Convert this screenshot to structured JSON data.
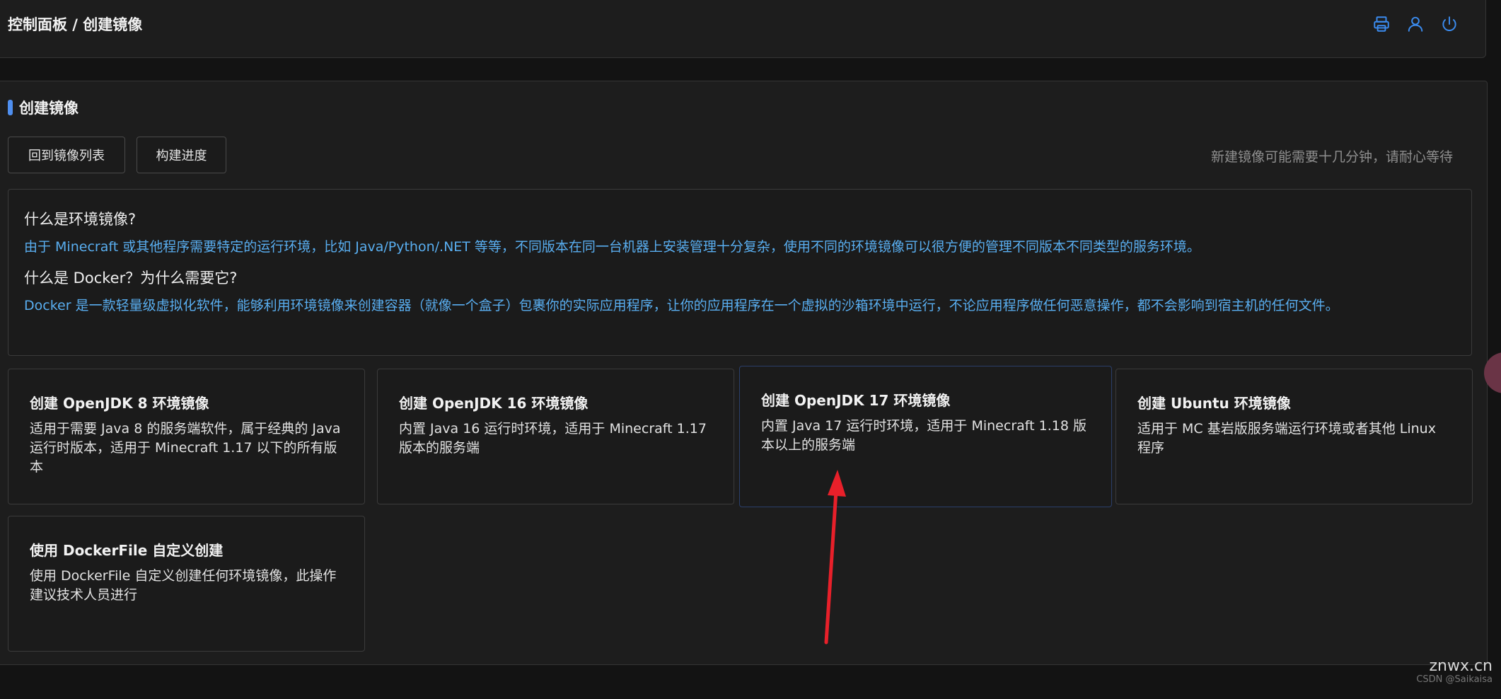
{
  "header": {
    "breadcrumb": "控制面板 / 创建镜像",
    "icons": [
      "printer-icon",
      "user-icon",
      "power-icon"
    ]
  },
  "panel": {
    "title": "创建镜像",
    "buttons": {
      "back": "回到镜像列表",
      "progress": "构建进度"
    },
    "hint": "新建镜像可能需要十几分钟，请耐心等待"
  },
  "info": {
    "q1": "什么是环境镜像?",
    "a1": "由于 Minecraft 或其他程序需要特定的运行环境，比如 Java/Python/.NET 等等，不同版本在同一台机器上安装管理十分复杂，使用不同的环境镜像可以很方便的管理不同版本不同类型的服务环境。",
    "q2": "什么是 Docker？为什么需要它?",
    "a2": "Docker 是一款轻量级虚拟化软件，能够利用环境镜像来创建容器（就像一个盒子）包裹你的实际应用程序，让你的应用程序在一个虚拟的沙箱环境中运行，不论应用程序做任何恶意操作，都不会影响到宿主机的任何文件。"
  },
  "cards": [
    {
      "title": "创建 OpenJDK 8 环境镜像",
      "desc": "适用于需要 Java 8 的服务端软件，属于经典的 Java 运行时版本，适用于 Minecraft 1.17 以下的所有版本"
    },
    {
      "title": "创建 OpenJDK 16 环境镜像",
      "desc": "内置 Java 16 运行时环境，适用于 Minecraft 1.17 版本的服务端"
    },
    {
      "title": "创建 OpenJDK 17 环境镜像",
      "desc": "内置 Java 17 运行时环境，适用于 Minecraft 1.18 版本以上的服务端"
    },
    {
      "title": "创建 Ubuntu 环境镜像",
      "desc": "适用于 MC 基岩版服务端运行环境或者其他 Linux 程序"
    },
    {
      "title": "使用 DockerFile 自定义创建",
      "desc": "使用 DockerFile 自定义创建任何环境镜像，此操作建议技术人员进行"
    }
  ],
  "watermark": {
    "site": "znwx.cn",
    "credit": "CSDN @Saikaisa"
  },
  "colors": {
    "accent": "#4f8ff0",
    "info_text": "#59aef0",
    "annotation_arrow": "#e8202a"
  }
}
